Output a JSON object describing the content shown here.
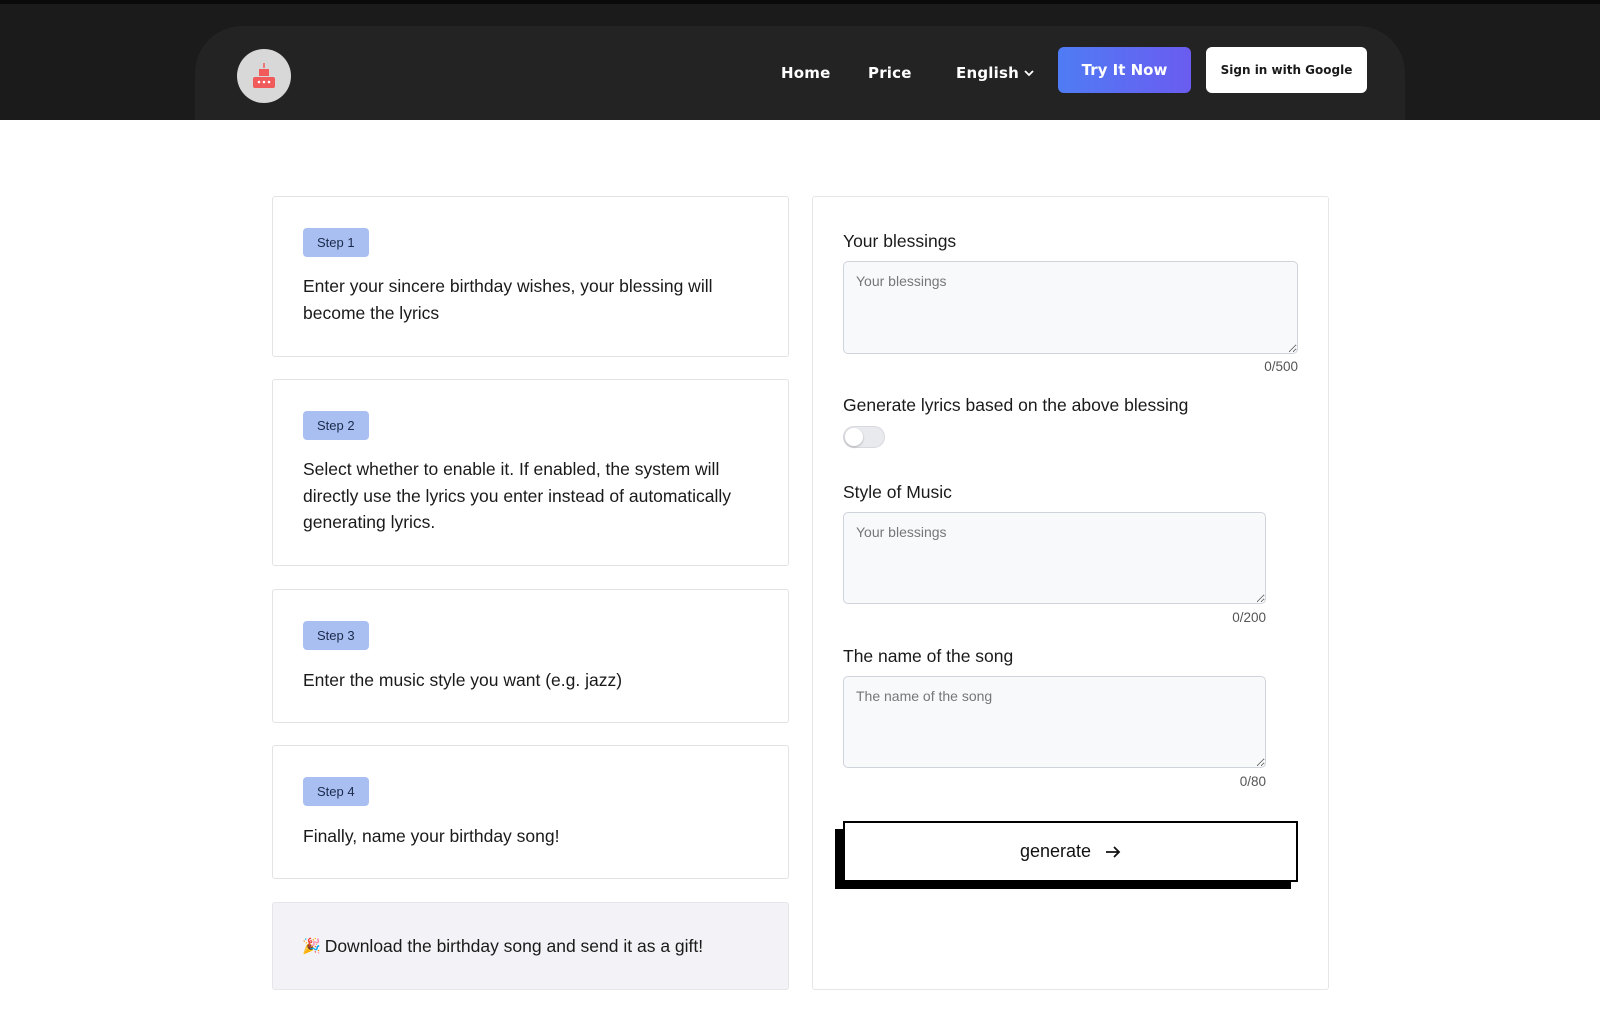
{
  "header": {
    "nav": {
      "home": "Home",
      "price": "Price",
      "language": "English"
    },
    "try_button": "Try It Now",
    "google_button": "Sign in with Google"
  },
  "steps": [
    {
      "badge": "Step 1",
      "text": "Enter your sincere birthday wishes, your blessing will become the lyrics"
    },
    {
      "badge": "Step 2",
      "text": "Select whether to enable it. If enabled, the system will directly use the lyrics you enter instead of automatically generating lyrics."
    },
    {
      "badge": "Step 3",
      "text": "Enter the music style you want (e.g. jazz)"
    },
    {
      "badge": "Step 4",
      "text": "Finally, name your birthday song!"
    }
  ],
  "gift": {
    "emoji": "🎉",
    "text": "Download the birthday song and send it as a gift!"
  },
  "form": {
    "blessings": {
      "label": "Your blessings",
      "placeholder": "Your blessings",
      "value": "",
      "counter": "0/500"
    },
    "generate_lyrics": {
      "label": "Generate lyrics based on the above blessing",
      "enabled": false
    },
    "style": {
      "label": "Style of Music",
      "placeholder": "Your blessings",
      "value": "",
      "counter": "0/200"
    },
    "song_name": {
      "label": "The name of the song",
      "placeholder": "The name of the song",
      "value": "",
      "counter": "0/80"
    },
    "generate_button": "generate"
  },
  "colors": {
    "header_bg": "#1b1b1b",
    "accent_gradient_start": "#4f7cf5",
    "accent_gradient_end": "#6a5cf0",
    "badge_bg": "#a9bff2",
    "logo_cake": "#f05a5a"
  }
}
